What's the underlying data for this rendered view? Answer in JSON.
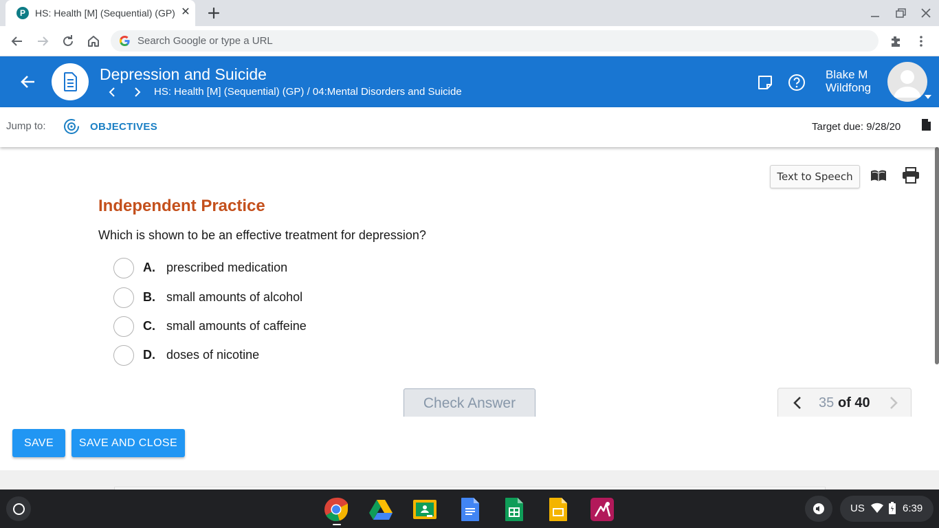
{
  "browser": {
    "tab_title": "HS: Health [M] (Sequential) (GP)",
    "favicon_letter": "P",
    "omnibox_placeholder": "Search Google or type a URL"
  },
  "header": {
    "title": "Depression and Suicide",
    "breadcrumb": "HS: Health [M] (Sequential) (GP) / 04:Mental Disorders and Suicide",
    "user_line1": "Blake M",
    "user_line2": "Wildfong",
    "color": "#1976d2"
  },
  "jumpbar": {
    "label": "Jump to:",
    "link": "OBJECTIVES",
    "target_due": "Target due: 9/28/20"
  },
  "content": {
    "tts_label": "Text to Speech",
    "section_title": "Independent Practice",
    "question": "Which is shown to be an effective treatment for depression?",
    "choices": [
      {
        "letter": "A.",
        "text": "prescribed medication"
      },
      {
        "letter": "B.",
        "text": "small amounts of alcohol"
      },
      {
        "letter": "C.",
        "text": "small amounts of caffeine"
      },
      {
        "letter": "D.",
        "text": "doses of nicotine"
      }
    ],
    "check_answer": "Check Answer",
    "pager": {
      "current": "35",
      "of_label": "of 40"
    }
  },
  "savebar": {
    "save": "SAVE",
    "save_close": "SAVE AND CLOSE"
  },
  "taskbar": {
    "apps": [
      "chrome-icon",
      "drive-icon",
      "classroom-icon",
      "docs-icon",
      "sheets-icon",
      "slides-icon",
      "app-icon"
    ],
    "lang": "US",
    "time": "6:39"
  }
}
